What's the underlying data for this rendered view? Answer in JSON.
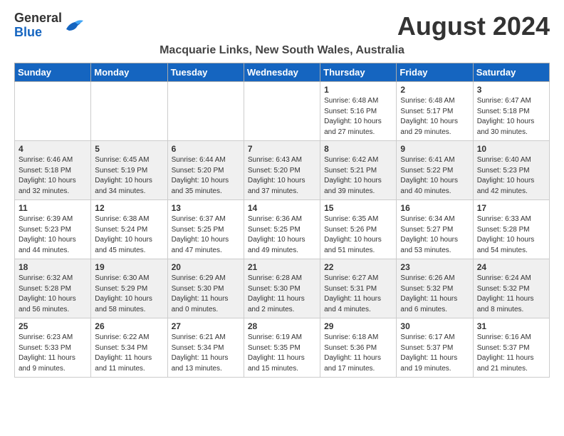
{
  "logo": {
    "general": "General",
    "blue": "Blue"
  },
  "header": {
    "month": "August 2024",
    "location": "Macquarie Links, New South Wales, Australia"
  },
  "weekdays": [
    "Sunday",
    "Monday",
    "Tuesday",
    "Wednesday",
    "Thursday",
    "Friday",
    "Saturday"
  ],
  "weeks": [
    [
      {
        "day": "",
        "info": ""
      },
      {
        "day": "",
        "info": ""
      },
      {
        "day": "",
        "info": ""
      },
      {
        "day": "",
        "info": ""
      },
      {
        "day": "1",
        "info": "Sunrise: 6:48 AM\nSunset: 5:16 PM\nDaylight: 10 hours\nand 27 minutes."
      },
      {
        "day": "2",
        "info": "Sunrise: 6:48 AM\nSunset: 5:17 PM\nDaylight: 10 hours\nand 29 minutes."
      },
      {
        "day": "3",
        "info": "Sunrise: 6:47 AM\nSunset: 5:18 PM\nDaylight: 10 hours\nand 30 minutes."
      }
    ],
    [
      {
        "day": "4",
        "info": "Sunrise: 6:46 AM\nSunset: 5:18 PM\nDaylight: 10 hours\nand 32 minutes."
      },
      {
        "day": "5",
        "info": "Sunrise: 6:45 AM\nSunset: 5:19 PM\nDaylight: 10 hours\nand 34 minutes."
      },
      {
        "day": "6",
        "info": "Sunrise: 6:44 AM\nSunset: 5:20 PM\nDaylight: 10 hours\nand 35 minutes."
      },
      {
        "day": "7",
        "info": "Sunrise: 6:43 AM\nSunset: 5:20 PM\nDaylight: 10 hours\nand 37 minutes."
      },
      {
        "day": "8",
        "info": "Sunrise: 6:42 AM\nSunset: 5:21 PM\nDaylight: 10 hours\nand 39 minutes."
      },
      {
        "day": "9",
        "info": "Sunrise: 6:41 AM\nSunset: 5:22 PM\nDaylight: 10 hours\nand 40 minutes."
      },
      {
        "day": "10",
        "info": "Sunrise: 6:40 AM\nSunset: 5:23 PM\nDaylight: 10 hours\nand 42 minutes."
      }
    ],
    [
      {
        "day": "11",
        "info": "Sunrise: 6:39 AM\nSunset: 5:23 PM\nDaylight: 10 hours\nand 44 minutes."
      },
      {
        "day": "12",
        "info": "Sunrise: 6:38 AM\nSunset: 5:24 PM\nDaylight: 10 hours\nand 45 minutes."
      },
      {
        "day": "13",
        "info": "Sunrise: 6:37 AM\nSunset: 5:25 PM\nDaylight: 10 hours\nand 47 minutes."
      },
      {
        "day": "14",
        "info": "Sunrise: 6:36 AM\nSunset: 5:25 PM\nDaylight: 10 hours\nand 49 minutes."
      },
      {
        "day": "15",
        "info": "Sunrise: 6:35 AM\nSunset: 5:26 PM\nDaylight: 10 hours\nand 51 minutes."
      },
      {
        "day": "16",
        "info": "Sunrise: 6:34 AM\nSunset: 5:27 PM\nDaylight: 10 hours\nand 53 minutes."
      },
      {
        "day": "17",
        "info": "Sunrise: 6:33 AM\nSunset: 5:28 PM\nDaylight: 10 hours\nand 54 minutes."
      }
    ],
    [
      {
        "day": "18",
        "info": "Sunrise: 6:32 AM\nSunset: 5:28 PM\nDaylight: 10 hours\nand 56 minutes."
      },
      {
        "day": "19",
        "info": "Sunrise: 6:30 AM\nSunset: 5:29 PM\nDaylight: 10 hours\nand 58 minutes."
      },
      {
        "day": "20",
        "info": "Sunrise: 6:29 AM\nSunset: 5:30 PM\nDaylight: 11 hours\nand 0 minutes."
      },
      {
        "day": "21",
        "info": "Sunrise: 6:28 AM\nSunset: 5:30 PM\nDaylight: 11 hours\nand 2 minutes."
      },
      {
        "day": "22",
        "info": "Sunrise: 6:27 AM\nSunset: 5:31 PM\nDaylight: 11 hours\nand 4 minutes."
      },
      {
        "day": "23",
        "info": "Sunrise: 6:26 AM\nSunset: 5:32 PM\nDaylight: 11 hours\nand 6 minutes."
      },
      {
        "day": "24",
        "info": "Sunrise: 6:24 AM\nSunset: 5:32 PM\nDaylight: 11 hours\nand 8 minutes."
      }
    ],
    [
      {
        "day": "25",
        "info": "Sunrise: 6:23 AM\nSunset: 5:33 PM\nDaylight: 11 hours\nand 9 minutes."
      },
      {
        "day": "26",
        "info": "Sunrise: 6:22 AM\nSunset: 5:34 PM\nDaylight: 11 hours\nand 11 minutes."
      },
      {
        "day": "27",
        "info": "Sunrise: 6:21 AM\nSunset: 5:34 PM\nDaylight: 11 hours\nand 13 minutes."
      },
      {
        "day": "28",
        "info": "Sunrise: 6:19 AM\nSunset: 5:35 PM\nDaylight: 11 hours\nand 15 minutes."
      },
      {
        "day": "29",
        "info": "Sunrise: 6:18 AM\nSunset: 5:36 PM\nDaylight: 11 hours\nand 17 minutes."
      },
      {
        "day": "30",
        "info": "Sunrise: 6:17 AM\nSunset: 5:37 PM\nDaylight: 11 hours\nand 19 minutes."
      },
      {
        "day": "31",
        "info": "Sunrise: 6:16 AM\nSunset: 5:37 PM\nDaylight: 11 hours\nand 21 minutes."
      }
    ]
  ]
}
